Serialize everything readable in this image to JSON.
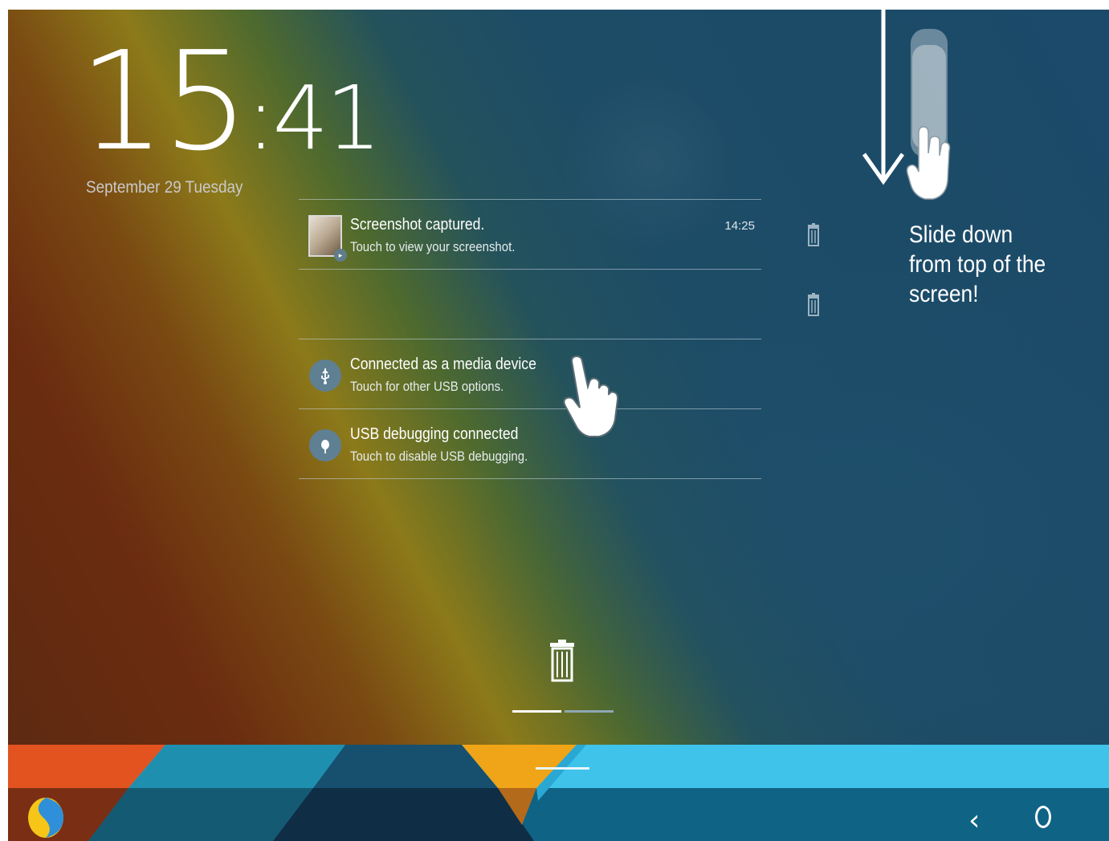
{
  "lockscreen": {
    "clock": {
      "hours": "15",
      "minutes": "41"
    },
    "date": "September 29  Tuesday"
  },
  "notifications": [
    {
      "icon": "screenshot-thumbnail",
      "title": "Screenshot captured.",
      "subtitle": "Touch to view your screenshot.",
      "time": "14:25"
    },
    {
      "icon": "usb-icon",
      "title": "Connected as a media device",
      "subtitle": "Touch for other USB options.",
      "time": ""
    },
    {
      "icon": "bug-icon",
      "title": "USB debugging connected",
      "subtitle": "Touch to disable USB debugging.",
      "time": ""
    }
  ],
  "hint": {
    "lines": [
      "Slide down",
      "from top of the",
      "screen!"
    ]
  },
  "pager": {
    "pages": 2,
    "current": 1
  },
  "navbar": {
    "back_icon": "back-chevron-icon",
    "home_icon": "home-icon",
    "launcher_icon": "launcher-logo-icon"
  },
  "colors": {
    "orange": "#e2531f",
    "yellow": "#f0a418",
    "cyan": "#3fc3ea",
    "teal_dark": "#0f5a78",
    "navy": "#123a55"
  }
}
